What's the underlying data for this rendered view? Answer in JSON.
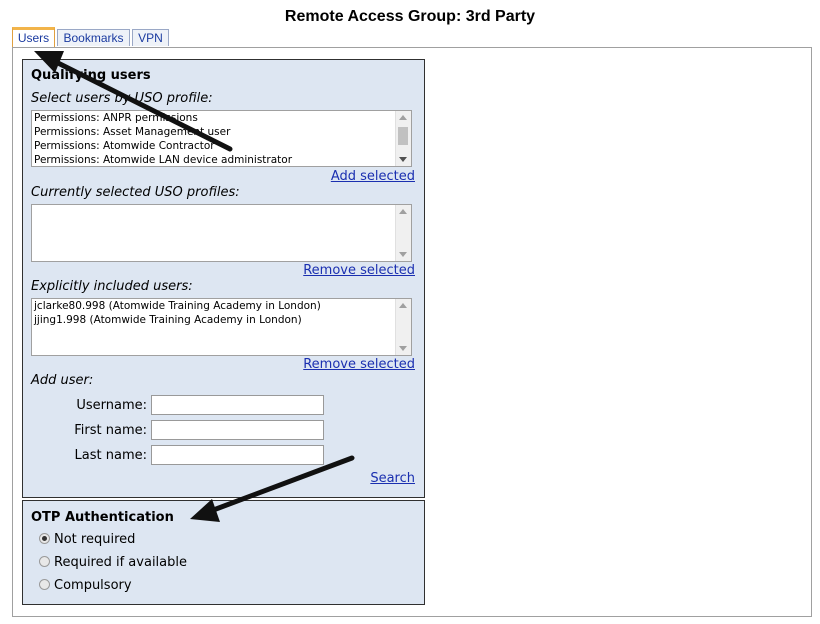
{
  "page_title": "Remote Access Group: 3rd Party",
  "tabs": [
    {
      "label": "Users",
      "active": true
    },
    {
      "label": "Bookmarks",
      "active": false
    },
    {
      "label": "VPN",
      "active": false
    }
  ],
  "qualifying": {
    "heading": "Qualifying users",
    "select_label": "Select users by USO profile:",
    "profiles": [
      "Permissions: ANPR permissions",
      "Permissions: Asset Management user",
      "Permissions: Atomwide Contractor",
      "Permissions: Atomwide LAN device administrator"
    ],
    "add_selected": "Add selected",
    "current_label": "Currently selected USO profiles:",
    "remove_selected_1": "Remove selected",
    "explicit_label": "Explicitly included users:",
    "explicit_users": [
      "jclarke80.998 (Atomwide Training Academy in London)",
      "jjing1.998 (Atomwide Training Academy in London)"
    ],
    "remove_selected_2": "Remove selected",
    "add_user_label": "Add user:",
    "username_label": "Username:",
    "firstname_label": "First name:",
    "lastname_label": "Last name:",
    "username_value": "",
    "firstname_value": "",
    "lastname_value": "",
    "search": "Search"
  },
  "otp": {
    "heading": "OTP Authentication",
    "options": [
      {
        "label": "Not required",
        "checked": true
      },
      {
        "label": "Required if available",
        "checked": false
      },
      {
        "label": "Compulsory",
        "checked": false
      }
    ]
  },
  "colors": {
    "panel_bg": "#dde6f2",
    "link": "#1a2fb0",
    "active_tab_accent": "#f2b44a"
  }
}
